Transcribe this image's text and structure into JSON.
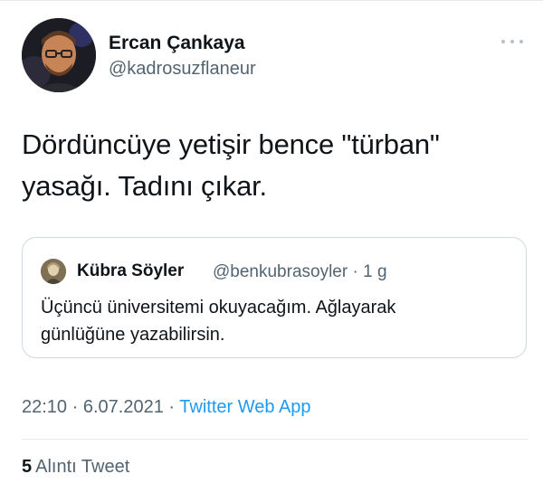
{
  "tweet": {
    "author": {
      "display_name": "Ercan Çankaya",
      "handle": "@kadrosuzflaneur",
      "avatar_icon": "avatar-photo"
    },
    "more_icon": "more-horizontal-icon",
    "text_line1": "Dördüncüye yetişir bence \"türban\"",
    "text_line2": "yasağı. Tadını çıkar.",
    "quoted": {
      "display_name": "Kübra Söyler",
      "handle": "@benkubrasoyler",
      "separator": "·",
      "age": "1 g",
      "text_line1": "Üçüncü üniversitemi okuyacağım. Ağlayarak",
      "text_line2": "günlüğüne yazabilirsin."
    },
    "meta": {
      "time": "22:10",
      "date": "6.07.2021",
      "separator": "·",
      "source": "Twitter Web App"
    },
    "stats": {
      "quote_count": "5",
      "quote_label": "Alıntı Tweet"
    }
  },
  "colors": {
    "text": "#0f1419",
    "secondary": "#536471",
    "link": "#1d9bf0",
    "border": "#cfd9de"
  }
}
